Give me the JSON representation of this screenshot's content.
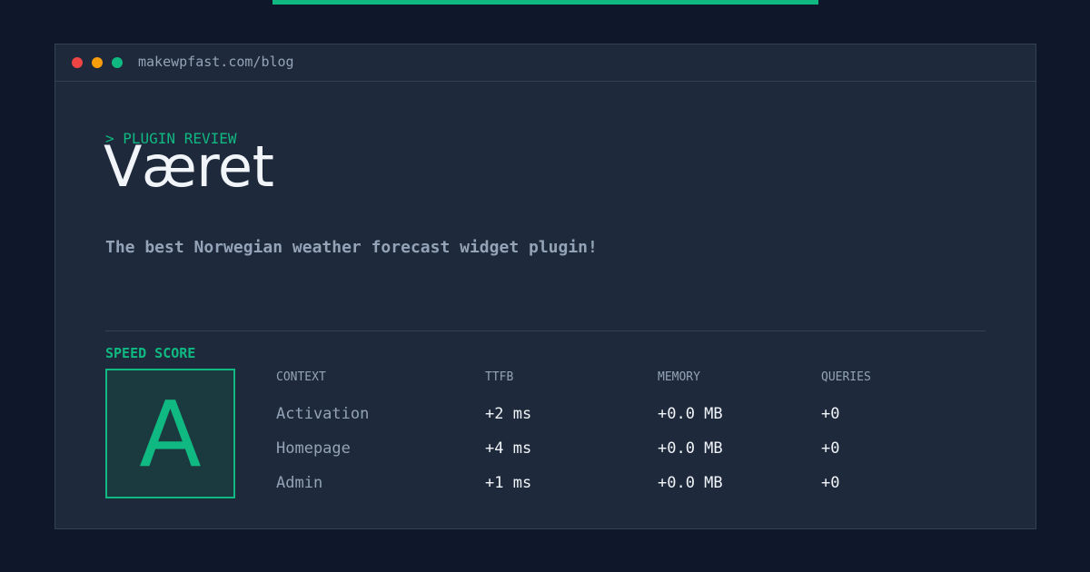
{
  "colors": {
    "background": "#0f172a",
    "panel": "#1e293b",
    "accent": "#10b981",
    "muted_text": "#94a3b8",
    "primary_text": "#f1f5f9",
    "window_dot_red": "#ef4444",
    "window_dot_yellow": "#f59e0b",
    "window_dot_green": "#10b981"
  },
  "window": {
    "url": "makewpfast.com/blog"
  },
  "header": {
    "kicker": "> PLUGIN REVIEW",
    "title": "Været",
    "tagline": "The best Norwegian weather forecast widget plugin!"
  },
  "score": {
    "label": "SPEED SCORE",
    "grade": "A"
  },
  "table": {
    "columns": [
      "CONTEXT",
      "TTFB",
      "MEMORY",
      "QUERIES"
    ],
    "rows": [
      [
        "Activation",
        "+2 ms",
        "+0.0 MB",
        "+0"
      ],
      [
        "Homepage",
        "+4 ms",
        "+0.0 MB",
        "+0"
      ],
      [
        "Admin",
        "+1 ms",
        "+0.0 MB",
        "+0"
      ]
    ]
  }
}
